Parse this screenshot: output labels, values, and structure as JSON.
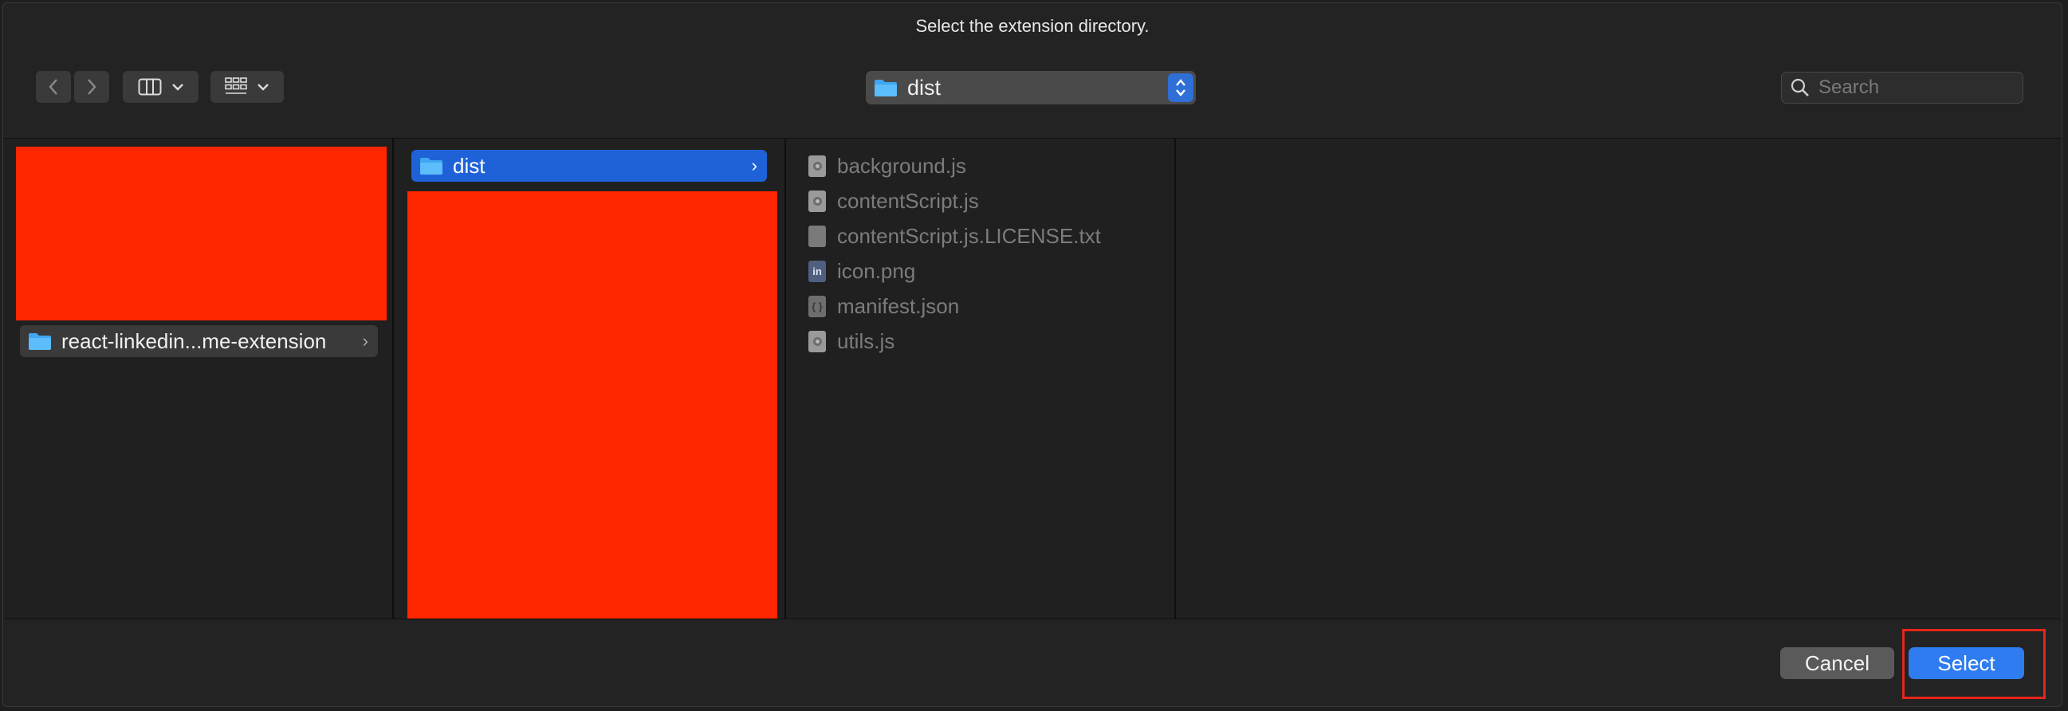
{
  "dialog": {
    "title": "Select the extension directory."
  },
  "toolbar": {
    "back_icon": "chevron-left-icon",
    "forward_icon": "chevron-right-icon",
    "view_columns_icon": "columns-view-icon",
    "view_gallery_icon": "grid-view-icon",
    "path_popup": {
      "label": "dist",
      "icon": "folder-icon"
    },
    "search": {
      "placeholder": "Search",
      "value": ""
    }
  },
  "columns": [
    {
      "selected_folder": "react-linkedin...me-extension"
    },
    {
      "selected_folder": "dist"
    },
    {
      "files": [
        {
          "name": "background.js",
          "icon": "chrome-file-icon"
        },
        {
          "name": "contentScript.js",
          "icon": "chrome-file-icon"
        },
        {
          "name": "contentScript.js.LICENSE.txt",
          "icon": "text-file-icon"
        },
        {
          "name": "icon.png",
          "icon": "linkedin-image-icon",
          "glyph": "in"
        },
        {
          "name": "manifest.json",
          "icon": "json-file-icon",
          "glyph": "{ }"
        },
        {
          "name": "utils.js",
          "icon": "chrome-file-icon"
        }
      ]
    }
  ],
  "colors": {
    "selection": "#1f62d8",
    "primary_button": "#2f7cf0",
    "redaction": "#ff2600",
    "highlight_box": "#e5261a"
  },
  "buttons": {
    "cancel": "Cancel",
    "select": "Select"
  }
}
